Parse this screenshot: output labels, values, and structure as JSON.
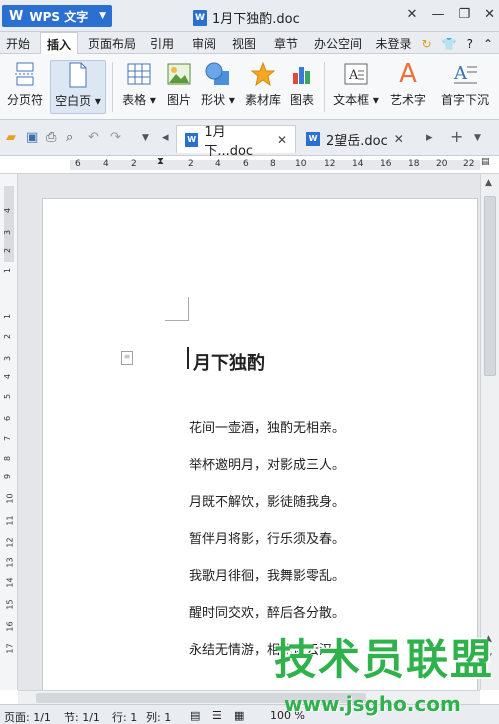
{
  "titlebar": {
    "app_name": "WPS 文字",
    "doc_title": "1月下独酌.doc"
  },
  "menubar": {
    "items": [
      "开始",
      "插入",
      "页面布局",
      "引用",
      "审阅",
      "视图",
      "章节",
      "办公空间"
    ],
    "active": "插入",
    "login": "未登录"
  },
  "ribbon": {
    "items": [
      {
        "label": "分页符"
      },
      {
        "label": "空白页"
      },
      {
        "label": "表格"
      },
      {
        "label": "图片"
      },
      {
        "label": "形状"
      },
      {
        "label": "素材库"
      },
      {
        "label": "图表"
      },
      {
        "label": "文本框"
      },
      {
        "label": "艺术字"
      },
      {
        "label": "首字下沉"
      }
    ]
  },
  "tabs": {
    "tab1": "1月下...doc",
    "tab2": "2望岳.doc"
  },
  "ruler": {
    "h_left": [
      "6",
      "4",
      "2"
    ],
    "h_right": [
      "2",
      "4",
      "6",
      "8",
      "10",
      "12",
      "14",
      "16",
      "18",
      "20",
      "22"
    ],
    "v_top": [
      "4",
      "3",
      "2",
      "1"
    ],
    "v_bottom": [
      "1",
      "2",
      "3",
      "4",
      "5",
      "6",
      "7",
      "8",
      "9",
      "10",
      "11",
      "12",
      "13",
      "14",
      "15",
      "16",
      "17"
    ]
  },
  "document": {
    "title": "月下独酌",
    "lines": [
      "花间一壶酒，独酌无相亲。",
      "举杯邀明月，对影成三人。",
      "月既不解饮，影徒随我身。",
      "暂伴月将影，行乐须及春。",
      "我歌月徘徊，我舞影零乱。",
      "醒时同交欢，醉后各分散。",
      "永结无情游，相期邈云汉。"
    ]
  },
  "status": {
    "page": "页面: 1/1",
    "section": "节: 1/1",
    "line": "行: 1",
    "col": "列: 1",
    "zoom": "100 %"
  },
  "watermark": {
    "text": "技术员联盟",
    "url": "www.jsgho.com"
  }
}
